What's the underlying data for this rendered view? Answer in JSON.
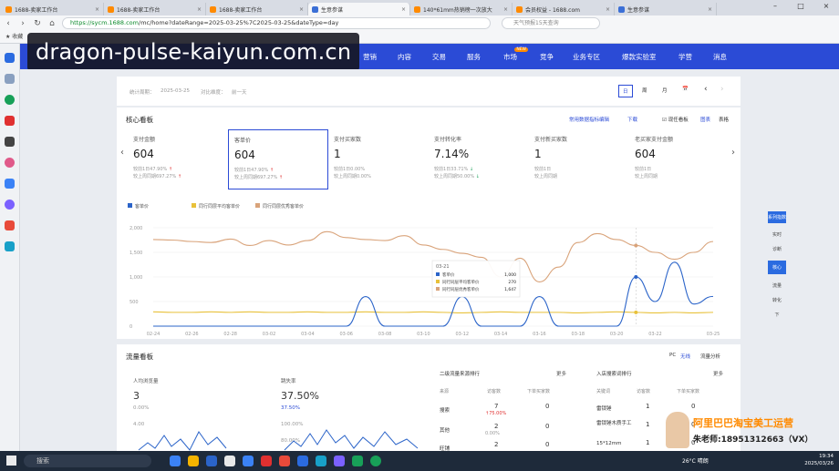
{
  "browser": {
    "tabs": [
      {
        "label": "1688-卖家工作台",
        "active": false
      },
      {
        "label": "1688-卖家工作台",
        "active": false
      },
      {
        "label": "1688-卖家工作台",
        "active": false
      },
      {
        "label": "生意参谋",
        "active": true
      },
      {
        "label": "140*61mm热销榜一次放大",
        "active": false
      },
      {
        "label": "会员权益 - 1688.com",
        "active": false
      },
      {
        "label": "生意参谋",
        "active": false
      }
    ],
    "url_host": "https://sycm.1688.com",
    "url_path": "/mc/home?dateRange=2025-03-25%7C2025-03-25&dateType=day",
    "search_placeholder": "天气预报15天查询",
    "bookmarks_label": "收藏"
  },
  "site_nav": {
    "items": [
      "营销",
      "内容",
      "交易",
      "服务",
      "市场",
      "竞争",
      "业务专区",
      "爆款实验室",
      "学营",
      "消息"
    ],
    "hot_badge": "NEW"
  },
  "watermark": "dragon-pulse-kaiyun.com.cn",
  "stats_bar": {
    "period_label": "统计周期：",
    "period_value": "2025-03-25",
    "compare_label": "对比维度：",
    "compare_value": "前一天",
    "date_buttons": [
      "日",
      "周",
      "月",
      "📅",
      "‹",
      "›"
    ]
  },
  "core_board": {
    "title": "核心看板",
    "actions": [
      "常用数据指标编辑",
      "下载",
      "现任看板",
      "图表",
      "表格"
    ],
    "metrics": [
      {
        "label": "支付金额",
        "value": "604",
        "line1": "较前1日47.90%",
        "line2": "较上周同期697.27%",
        "dir": "up"
      },
      {
        "label": "客单价",
        "value": "604",
        "line1": "较前1日47.90%",
        "line2": "较上周同期697.27%",
        "dir": "up"
      },
      {
        "label": "支付买家数",
        "value": "1",
        "line1": "较前1日0.00%",
        "line2": "较上周同期0.00%",
        "dir": "flat"
      },
      {
        "label": "支付转化率",
        "value": "7.14%",
        "line1": "较前1日33.71%",
        "line2": "较上周同期50.00%",
        "dir": "down"
      },
      {
        "label": "支付新买家数",
        "value": "1",
        "line1": "较前1日",
        "line2": "较上周同期",
        "dir": "flat"
      },
      {
        "label": "老买家支付金额",
        "value": "604",
        "line1": "较前1日",
        "line2": "较上周同期",
        "dir": "flat"
      }
    ],
    "right_tabs": [
      "系列指数",
      "实时",
      "诊断",
      "核心",
      "流量",
      "转化",
      "下"
    ],
    "right_tab_active": "核心"
  },
  "chart_data": {
    "type": "line",
    "x": [
      "02-24",
      "02-25",
      "02-26",
      "02-27",
      "02-28",
      "03-01",
      "03-02",
      "03-03",
      "03-04",
      "03-05",
      "03-06",
      "03-07",
      "03-08",
      "03-09",
      "03-10",
      "03-11",
      "03-12",
      "03-13",
      "03-14",
      "03-15",
      "03-16",
      "03-17",
      "03-18",
      "03-19",
      "03-20",
      "03-21",
      "03-22",
      "03-23",
      "03-24",
      "03-25"
    ],
    "x_tick_labels": [
      "02-24",
      "02-26",
      "02-28",
      "03-02",
      "03-04",
      "03-06",
      "03-08",
      "03-10",
      "03-12",
      "03-14",
      "03-16",
      "03-18",
      "03-20",
      "03-22",
      "03-25"
    ],
    "ylim": [
      0,
      2000
    ],
    "y_ticks": [
      "0",
      "500",
      "1,000",
      "1,500",
      "2,000"
    ],
    "series": [
      {
        "name": "客单价",
        "color": "#2b64c9",
        "values": [
          0,
          0,
          0,
          0,
          0,
          0,
          0,
          0,
          0,
          0,
          0,
          600,
          0,
          0,
          0,
          0,
          600,
          0,
          0,
          0,
          600,
          0,
          0,
          0,
          0,
          1000,
          500,
          1300,
          450,
          604
        ]
      },
      {
        "name": "同行同层平均客单价",
        "color": "#e8c13a",
        "values": [
          290,
          280,
          280,
          290,
          280,
          290,
          280,
          280,
          290,
          280,
          280,
          290,
          280,
          280,
          290,
          280,
          270,
          280,
          290,
          280,
          280,
          280,
          270,
          280,
          290,
          280,
          270,
          280,
          270,
          280
        ]
      },
      {
        "name": "同行同层优秀客单价",
        "color": "#d9a37a",
        "values": [
          1760,
          1750,
          1720,
          1700,
          1770,
          1640,
          1740,
          1650,
          1740,
          1920,
          1800,
          1760,
          1740,
          1840,
          1650,
          1560,
          1480,
          1400,
          1000,
          1380,
          900,
          1200,
          1700,
          1880,
          1760,
          1640,
          1500,
          1360,
          1500,
          1720
        ]
      }
    ],
    "tooltip": {
      "date": "03-21",
      "rows": [
        {
          "name": "客单价",
          "value": "1,000"
        },
        {
          "name": "同行同层平均客单价",
          "value": "270"
        },
        {
          "name": "同行同层优秀客单价",
          "value": "1,647"
        }
      ]
    }
  },
  "traffic_board": {
    "title": "流量看板",
    "actions": [
      "PC",
      "无线",
      "流量分析"
    ],
    "visitors_label": "人均浏览量",
    "visitors_value": "3",
    "visitors_sub": "0.00%",
    "bounce_label": "跳失率",
    "bounce_value": "37.50%",
    "bounce_sub": "37.50%",
    "chart_ticks": [
      "4.00",
      "100.00%",
      "80.00%"
    ],
    "source_table": {
      "title": "二级流量来源排行",
      "more": "更多",
      "headers": [
        "来源",
        "访客数",
        "下单买家数"
      ],
      "rows": [
        {
          "name": "搜索",
          "visitors": "7",
          "change": "75.00%",
          "buyers": "0"
        },
        {
          "name": "其他",
          "visitors": "2",
          "change": "0.00%",
          "buyers": "0"
        },
        {
          "name": "旺铺",
          "visitors": "2",
          "change": "",
          "buyers": "0"
        }
      ]
    },
    "keyword_table": {
      "title": "入店搜索词排行",
      "more": "更多",
      "headers": [
        "关键词",
        "访客数",
        "下单买家数"
      ],
      "rows": [
        {
          "name": "雷锁锤",
          "visitors": "1",
          "buyers": "0"
        },
        {
          "name": "雷锁锤木质手工",
          "visitors": "1",
          "buyers": "0"
        },
        {
          "name": "15*12mm",
          "visitors": "1",
          "buyers": "0"
        }
      ]
    }
  },
  "promo": {
    "line1": "阿里巴巴淘宝美工运营",
    "line2": "朱老师:18951312663（VX）"
  },
  "taskbar": {
    "search_label": "搜索",
    "weather": "26°C 晴朗",
    "time": "19:34",
    "date": "2025/03/26"
  }
}
